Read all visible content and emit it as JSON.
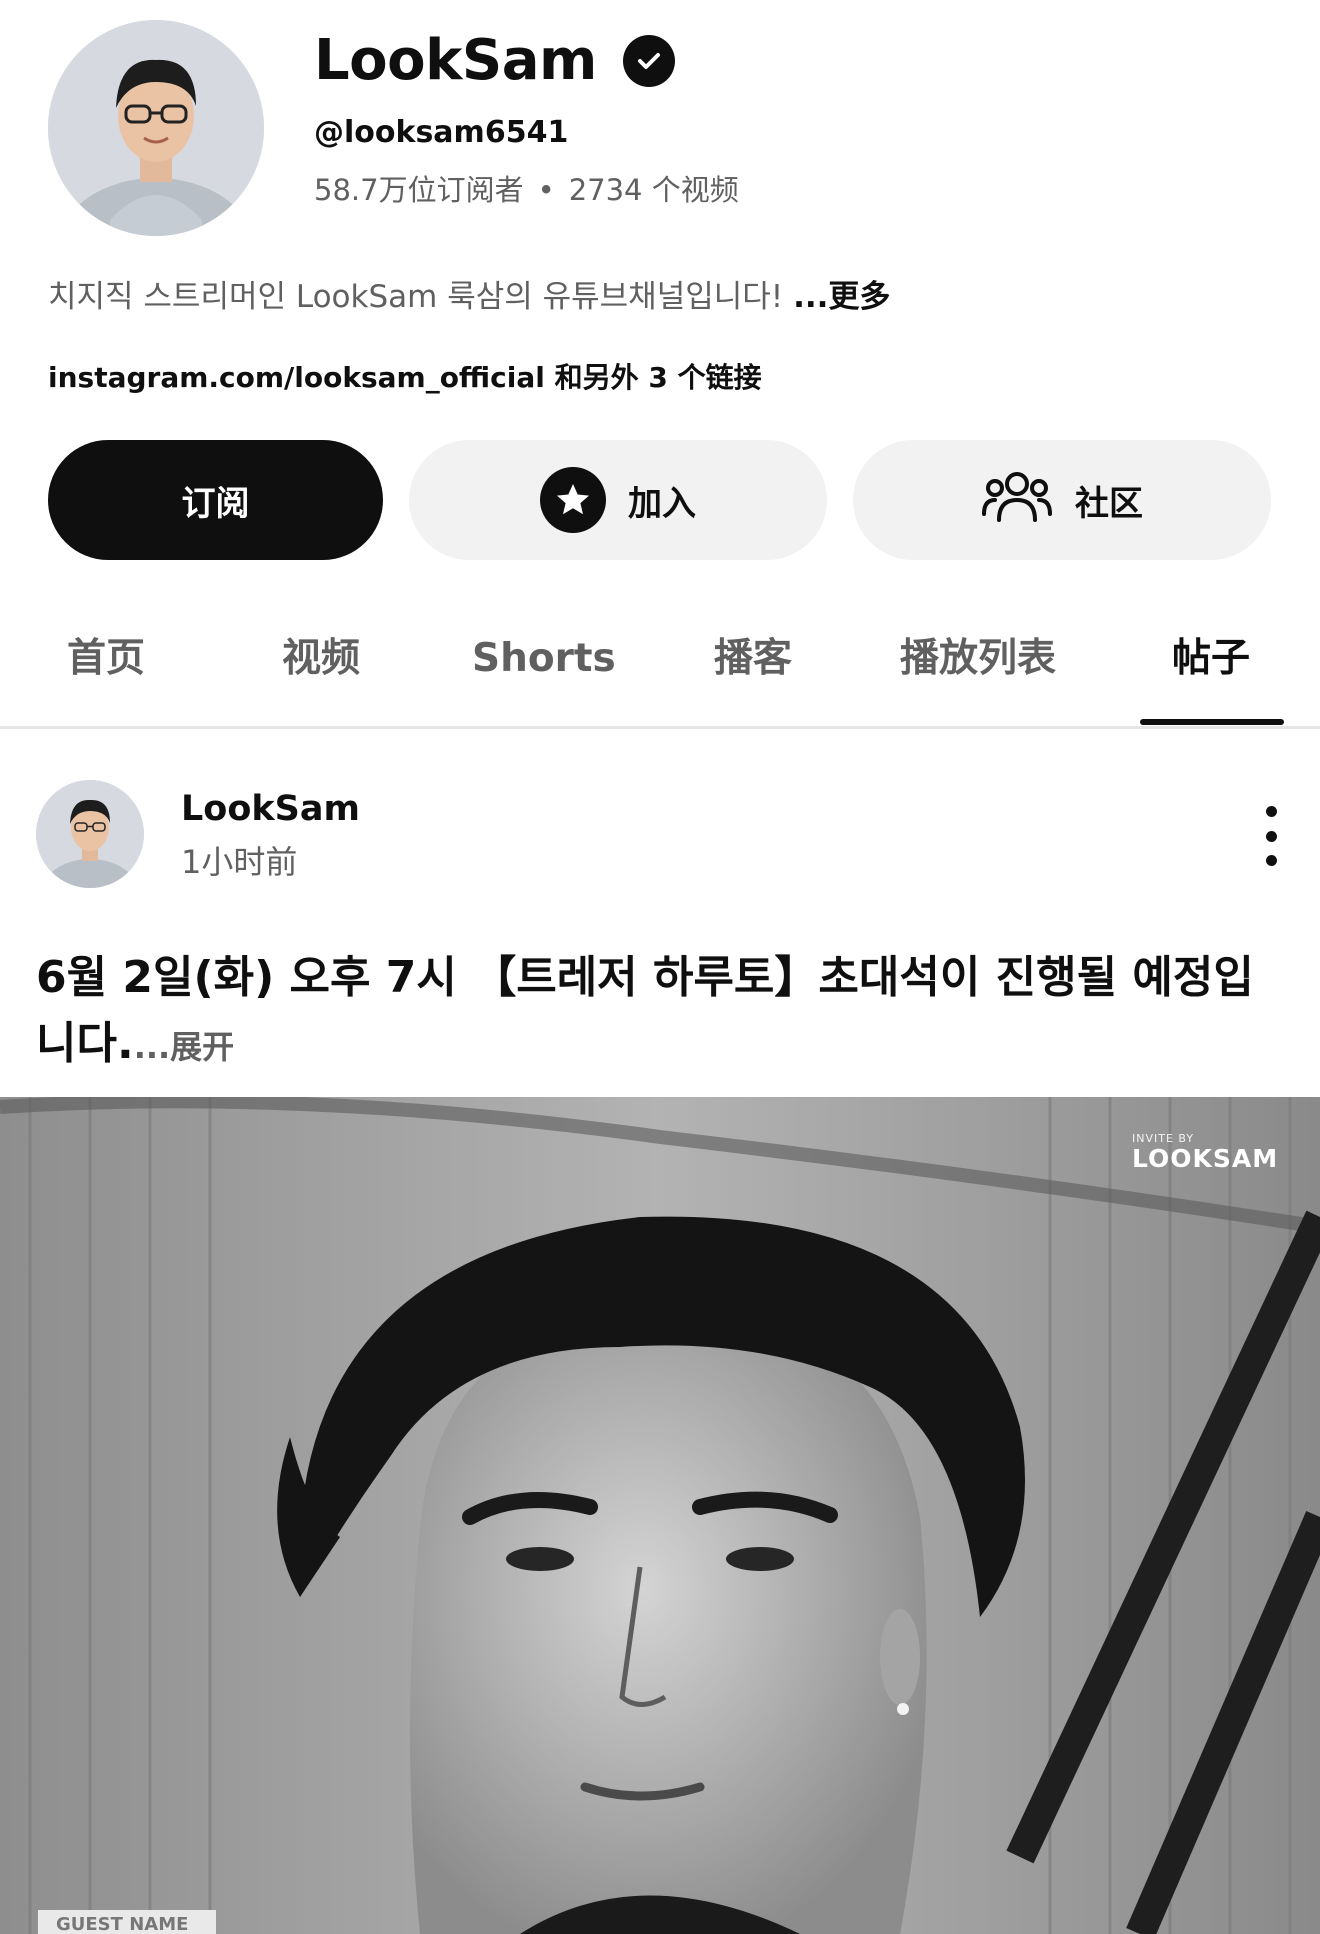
{
  "channel": {
    "name": "LookSam",
    "handle": "@looksam6541",
    "subscribers": "58.7万位订阅者",
    "separator": "•",
    "videos": "2734 个视频",
    "description": "치지직 스트리머인 LookSam 룩삼의 유튜브채널입니다!",
    "description_more": "...更多",
    "links": "instagram.com/looksam_official 和另外 3 个链接"
  },
  "buttons": {
    "subscribe": "订阅",
    "join": "加入",
    "community": "社区"
  },
  "tabs": [
    {
      "label": "首页"
    },
    {
      "label": "视频"
    },
    {
      "label": "Shorts"
    },
    {
      "label": "播客"
    },
    {
      "label": "播放列表"
    },
    {
      "label": "帖子",
      "active": true
    }
  ],
  "post": {
    "author": "LookSam",
    "time": "1小时前",
    "text": "6월 2일(화) 오후 7시 【트레저 하루토】초대석이 진행될 예정입니다.",
    "expand": "...展开",
    "image": {
      "watermark_small": "INVITE BY",
      "watermark_logo": "LOOKSAM",
      "guest_label": "GUEST NAME"
    }
  },
  "colors": {
    "primary_text": "#0f0f0f",
    "secondary_text": "#606060",
    "button_bg": "#f2f2f2",
    "divider": "#e5e5e5"
  }
}
